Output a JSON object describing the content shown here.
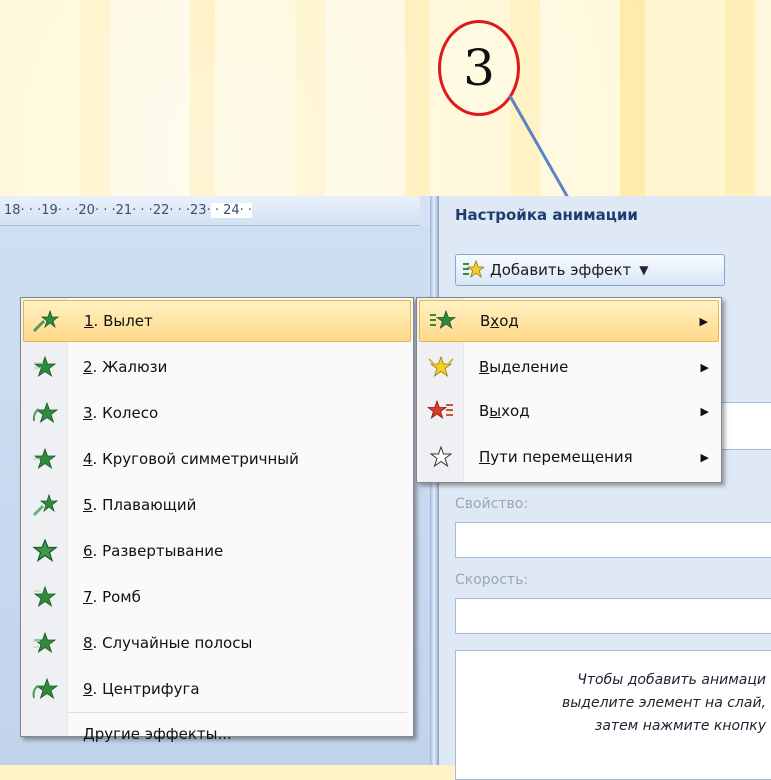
{
  "annotation": {
    "number": "3"
  },
  "ruler": {
    "text": "18· · ·19· · ·20· · ·21· · ·22· · ·23·",
    "highlight": " · 24· ·"
  },
  "pane": {
    "title": "Настройка анимации",
    "add_effect_button": "Добавить эффект",
    "property_label": "Свойство:",
    "speed_label": "Скорость:",
    "hint_lines": [
      "Чтобы добавить анимаци",
      "выделите элемент на слай,",
      "затем нажмите кнопку"
    ]
  },
  "effects_menu": {
    "items": [
      {
        "num": "1",
        "label": ". Вылет",
        "icon": "fly-in-star-icon",
        "highlighted": true
      },
      {
        "num": "2",
        "label": ". Жалюзи",
        "icon": "blinds-star-icon"
      },
      {
        "num": "3",
        "label": ". Колесо",
        "icon": "wheel-star-icon"
      },
      {
        "num": "4",
        "label": ". Круговой симметричный",
        "icon": "circle-star-icon"
      },
      {
        "num": "5",
        "label": ". Плавающий",
        "icon": "float-star-icon"
      },
      {
        "num": "6",
        "label": ". Развертывание",
        "icon": "expand-star-icon"
      },
      {
        "num": "7",
        "label": ". Ромб",
        "icon": "diamond-star-icon"
      },
      {
        "num": "8",
        "label": ". Случайные полосы",
        "icon": "random-bars-star-icon"
      },
      {
        "num": "9",
        "label": ". Центрифуга",
        "icon": "spinner-star-icon"
      }
    ],
    "more": "Другие эффекты..."
  },
  "category_menu": {
    "items": [
      {
        "label_pre": "В",
        "label_ul": "х",
        "label_post": "од",
        "icon": "entrance-star-icon",
        "highlighted": true
      },
      {
        "label_pre": "",
        "label_ul": "В",
        "label_post": "ыделение",
        "icon": "emphasis-star-icon"
      },
      {
        "label_pre": "В",
        "label_ul": "ы",
        "label_post": "ход",
        "icon": "exit-star-icon"
      },
      {
        "label_pre": "",
        "label_ul": "П",
        "label_post": "ути перемещения",
        "icon": "motion-path-star-icon"
      }
    ]
  },
  "colors": {
    "accent_red": "#e01818",
    "highlight": "#ffd98a",
    "pane_title": "#1e3d6e"
  }
}
